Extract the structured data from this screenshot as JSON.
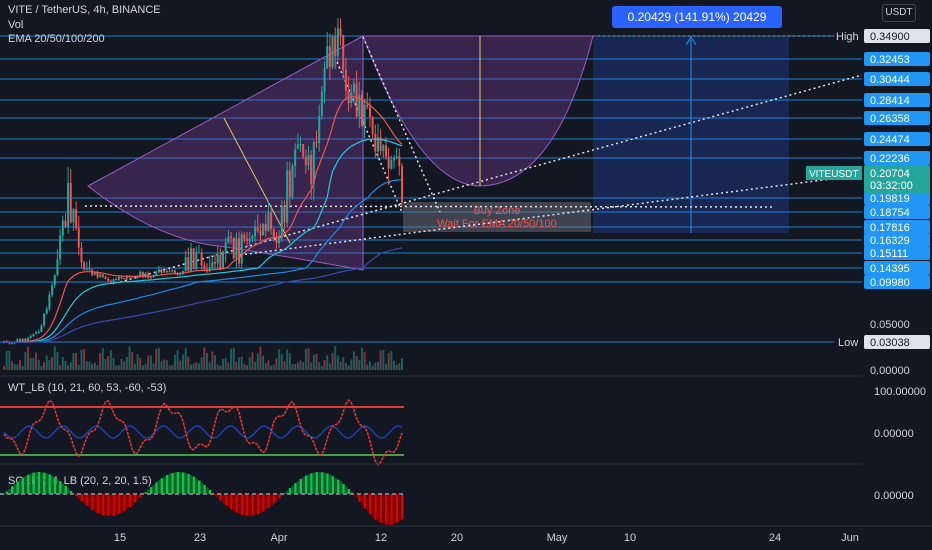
{
  "header": {
    "symbol_line": "VITE / TetherUS, 4h, BINANCE",
    "vol_label": "Vol",
    "ema_label": "EMA 20/50/100/200",
    "currency": "USDT"
  },
  "measure_label": "0.20429 (141.91%) 20429",
  "buy_zone": {
    "line1": "Buy Zone",
    "line2": "Wait For EMA 20/50/100"
  },
  "colors": {
    "background": "#131722",
    "hline": "#2196f3",
    "candle_up": "#26a69a",
    "candle_down": "#ef5350",
    "ema20": "#ef5350",
    "ema50": "#26c6da",
    "ema100": "#1e88e5",
    "ema200": "#3949ab",
    "measure": "#2962ff",
    "cup": "#7b3fa0"
  },
  "chart_data": [
    {
      "type": "line",
      "title": "VITE / TetherUS, 4h, BINANCE",
      "x_ticks": [
        "15",
        "23",
        "Apr",
        "12",
        "20",
        "May",
        "10",
        "24",
        "Jun"
      ],
      "price_levels": [
        "0.34900",
        "0.32453",
        "0.30444",
        "0.28414",
        "0.26358",
        "0.24474",
        "0.22236",
        "0.19819",
        "0.18754",
        "0.17816",
        "0.16329",
        "0.15111",
        "0.14395",
        "0.09980",
        "0.03038"
      ],
      "axis_labels": [
        "0.05000",
        "0.00000"
      ],
      "high_label": "High",
      "high_value": "0.34900",
      "low_label": "Low",
      "low_value": "0.03038",
      "last_symbol": "VITEUSDT",
      "last_price": "0.20704",
      "countdown": "03:32:00",
      "ylim": [
        0,
        0.365
      ],
      "series": [
        {
          "values": [
            0.03,
            0.031,
            0.032,
            0.035,
            0.045,
            0.08,
            0.15,
            0.198,
            0.175,
            0.14,
            0.125,
            0.112,
            0.105,
            0.115,
            0.11,
            0.125,
            0.118,
            0.13,
            0.135,
            0.128,
            0.14,
            0.15,
            0.138,
            0.145,
            0.15,
            0.16,
            0.155,
            0.175,
            0.17,
            0.18,
            0.165,
            0.19,
            0.22,
            0.23,
            0.21,
            0.29,
            0.33,
            0.349,
            0.3,
            0.28,
            0.265,
            0.245,
            0.23,
            0.215,
            0.207
          ]
        }
      ]
    },
    {
      "type": "line",
      "title": "WT_LB (10, 21, 60, 53, -60, -53)",
      "axis_labels": [
        "100.00000",
        "0.00000"
      ]
    },
    {
      "type": "bar",
      "title": "SQZMOM_LB (20, 2, 20, 1.5)",
      "axis_labels": [
        "0.00000"
      ]
    }
  ]
}
